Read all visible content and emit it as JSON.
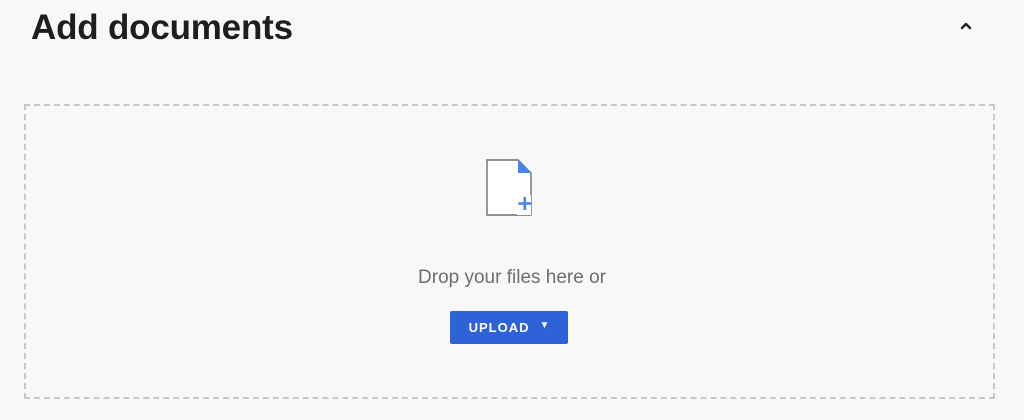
{
  "section": {
    "title": "Add documents",
    "toggle_icon": "chevron-up-icon"
  },
  "drop_zone": {
    "icon": "file-add-icon",
    "text": "Drop your files here or",
    "upload_label": "UPLOAD",
    "upload_caret_icon": "caret-down-icon",
    "upload_caret": "▼"
  },
  "colors": {
    "background": "#f8f8f8",
    "title": "#1e1e1e",
    "accent": "#2d63d6",
    "icon_accent": "#4a86e8",
    "dashed_border": "#c8c8c8",
    "secondary_text": "#6e6e6e"
  }
}
